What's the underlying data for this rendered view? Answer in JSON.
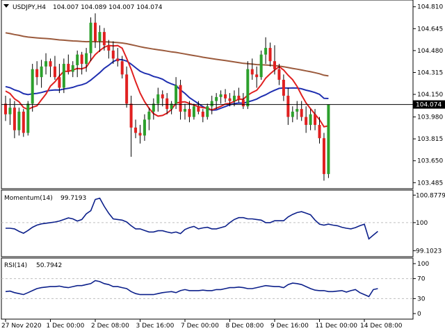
{
  "header": {
    "symbol": "USDJPY,H4",
    "ohlc": "104.007 104.089 104.007 104.074"
  },
  "colors": {
    "bull": "#2ca02c",
    "bear": "#e02020",
    "sma_fast": "#e02020",
    "sma_mid": "#1f2fb0",
    "sma_slow": "#9b5a3c",
    "indicator_line": "#0b1f8a",
    "grid": "#bfbfbf"
  },
  "chart_data": [
    {
      "type": "candlestick",
      "title": "USDJPY,H4",
      "ylim": [
        103.45,
        104.84
      ],
      "y_ticks": [
        "104.810",
        "104.645",
        "104.480",
        "104.315",
        "104.150",
        "103.980",
        "103.815",
        "103.650",
        "103.485"
      ],
      "current_price": "104.074",
      "x_labels": [
        "27 Nov 2020",
        "1 Dec 00:00",
        "2 Dec 08:00",
        "3 Dec 16:00",
        "7 Dec 00:00",
        "8 Dec 08:00",
        "9 Dec 16:00",
        "11 Dec 00:00",
        "14 Dec 08:00"
      ],
      "x_label_index": [
        0,
        10,
        20,
        30,
        40,
        50,
        60,
        70,
        80
      ],
      "candles": [
        [
          104.08,
          104.14,
          103.95,
          104.0
        ],
        [
          104.0,
          104.12,
          103.92,
          104.05
        ],
        [
          104.05,
          104.1,
          103.82,
          103.88
        ],
        [
          103.88,
          104.05,
          103.84,
          104.02
        ],
        [
          104.02,
          104.04,
          103.83,
          103.86
        ],
        [
          103.86,
          104.1,
          103.84,
          104.08
        ],
        [
          104.08,
          104.38,
          104.02,
          104.34
        ],
        [
          104.34,
          104.4,
          104.22,
          104.28
        ],
        [
          104.28,
          104.41,
          104.2,
          104.36
        ],
        [
          104.36,
          104.46,
          104.3,
          104.4
        ],
        [
          104.4,
          104.42,
          104.28,
          104.36
        ],
        [
          104.36,
          104.44,
          104.26,
          104.28
        ],
        [
          104.28,
          104.38,
          104.16,
          104.2
        ],
        [
          104.2,
          104.42,
          104.16,
          104.38
        ],
        [
          104.38,
          104.45,
          104.3,
          104.32
        ],
        [
          104.32,
          104.4,
          104.28,
          104.37
        ],
        [
          104.37,
          104.48,
          104.28,
          104.45
        ],
        [
          104.45,
          104.47,
          104.3,
          104.38
        ],
        [
          104.38,
          104.5,
          104.32,
          104.46
        ],
        [
          104.46,
          104.73,
          104.4,
          104.69
        ],
        [
          104.69,
          104.76,
          104.5,
          104.55
        ],
        [
          104.55,
          104.67,
          104.47,
          104.62
        ],
        [
          104.62,
          104.65,
          104.48,
          104.52
        ],
        [
          104.52,
          104.56,
          104.42,
          104.48
        ],
        [
          104.48,
          104.55,
          104.38,
          104.42
        ],
        [
          104.42,
          104.5,
          104.36,
          104.4
        ],
        [
          104.4,
          104.44,
          104.27,
          104.3
        ],
        [
          104.3,
          104.36,
          104.05,
          104.08
        ],
        [
          104.08,
          104.14,
          103.68,
          103.9
        ],
        [
          103.9,
          103.96,
          103.82,
          103.86
        ],
        [
          103.86,
          103.92,
          103.78,
          103.84
        ],
        [
          103.84,
          104.0,
          103.8,
          103.96
        ],
        [
          103.96,
          104.05,
          103.88,
          104.02
        ],
        [
          104.02,
          104.12,
          103.96,
          104.08
        ],
        [
          104.08,
          104.2,
          104.02,
          104.15
        ],
        [
          104.15,
          104.18,
          104.06,
          104.12
        ],
        [
          104.12,
          104.16,
          104.0,
          104.04
        ],
        [
          104.04,
          104.1,
          104.0,
          104.08
        ],
        [
          104.08,
          104.28,
          104.04,
          104.22
        ],
        [
          104.22,
          104.26,
          103.96,
          104.02
        ],
        [
          104.02,
          104.08,
          103.96,
          104.04
        ],
        [
          104.04,
          104.1,
          103.94,
          103.98
        ],
        [
          103.98,
          104.08,
          103.96,
          104.06
        ],
        [
          104.06,
          104.1,
          104.0,
          104.02
        ],
        [
          104.02,
          104.04,
          103.94,
          103.98
        ],
        [
          103.98,
          104.08,
          103.96,
          104.06
        ],
        [
          104.06,
          104.14,
          104.0,
          104.1
        ],
        [
          104.1,
          104.16,
          104.04,
          104.13
        ],
        [
          104.13,
          104.18,
          104.08,
          104.15
        ],
        [
          104.15,
          104.19,
          104.09,
          104.12
        ],
        [
          104.12,
          104.16,
          104.06,
          104.1
        ],
        [
          104.1,
          104.18,
          104.06,
          104.14
        ],
        [
          104.14,
          104.2,
          104.09,
          104.11
        ],
        [
          104.11,
          104.16,
          104.04,
          104.06
        ],
        [
          104.06,
          104.4,
          104.04,
          104.34
        ],
        [
          104.34,
          104.42,
          104.26,
          104.3
        ],
        [
          104.3,
          104.36,
          104.2,
          104.28
        ],
        [
          104.28,
          104.48,
          104.26,
          104.45
        ],
        [
          104.45,
          104.58,
          104.38,
          104.5
        ],
        [
          104.5,
          104.54,
          104.36,
          104.4
        ],
        [
          104.4,
          104.52,
          104.3,
          104.34
        ],
        [
          104.34,
          104.38,
          104.22,
          104.26
        ],
        [
          104.26,
          104.3,
          104.1,
          104.14
        ],
        [
          104.14,
          104.2,
          103.92,
          103.98
        ],
        [
          103.98,
          104.06,
          103.94,
          104.02
        ],
        [
          104.02,
          104.1,
          103.96,
          104.04
        ],
        [
          104.04,
          104.1,
          103.95,
          103.98
        ],
        [
          103.98,
          104.06,
          103.86,
          103.92
        ],
        [
          103.92,
          104.04,
          103.88,
          104.0
        ],
        [
          104.0,
          104.04,
          103.88,
          103.92
        ],
        [
          103.92,
          103.98,
          103.78,
          103.82
        ],
        [
          103.82,
          103.86,
          103.5,
          103.55
        ],
        [
          103.55,
          104.06,
          103.52,
          104.074
        ]
      ]
    },
    {
      "type": "line",
      "title": "Momentum(14) 99.7193",
      "name_label": "Momentum(14)",
      "value_label": "99.7193",
      "y_ticks": [
        "100.8779",
        "100",
        "99.1023"
      ],
      "ylim": [
        99.0,
        100.95
      ],
      "values": [
        99.82,
        99.82,
        99.8,
        99.72,
        99.66,
        99.75,
        99.85,
        99.92,
        99.96,
        99.98,
        100.0,
        100.02,
        100.05,
        100.1,
        100.15,
        100.12,
        100.05,
        100.1,
        100.28,
        100.38,
        100.74,
        100.78,
        100.52,
        100.3,
        100.12,
        100.1,
        100.08,
        100.02,
        99.9,
        99.8,
        99.8,
        99.75,
        99.7,
        99.7,
        99.74,
        99.74,
        99.7,
        99.67,
        99.7,
        99.65,
        99.78,
        99.84,
        99.88,
        99.8,
        99.83,
        99.85,
        99.8,
        99.8,
        99.84,
        99.88,
        100.0,
        100.1,
        100.16,
        100.16,
        100.12,
        100.12,
        100.1,
        100.08,
        100.0,
        100.0,
        100.06,
        100.06,
        100.06,
        100.18,
        100.26,
        100.32,
        100.35,
        100.3,
        100.25,
        100.08,
        99.95,
        99.92,
        99.95,
        99.92,
        99.9,
        99.85,
        99.82,
        99.8,
        99.84,
        99.9,
        99.95,
        99.48,
        99.6,
        99.72
      ],
      "reference_level": 100
    },
    {
      "type": "line",
      "title": "RSI(14) 50.7942",
      "name_label": "RSI(14)",
      "value_label": "50.7942",
      "y_ticks": [
        "100",
        "70",
        "30",
        "0"
      ],
      "ylim": [
        0,
        100
      ],
      "levels": [
        70,
        30
      ],
      "values": [
        44,
        45,
        42,
        40,
        38,
        42,
        46,
        50,
        52,
        53,
        54,
        54,
        55,
        53,
        52,
        54,
        56,
        56,
        58,
        60,
        66,
        64,
        60,
        58,
        54,
        54,
        52,
        50,
        44,
        40,
        38,
        38,
        38,
        38,
        40,
        42,
        43,
        44,
        42,
        46,
        48,
        46,
        46,
        46,
        47,
        46,
        46,
        48,
        48,
        50,
        52,
        52,
        53,
        52,
        50,
        50,
        52,
        54,
        56,
        55,
        54,
        54,
        52,
        58,
        61,
        60,
        58,
        54,
        50,
        47,
        46,
        46,
        44,
        44,
        45,
        46,
        43,
        46,
        48,
        42,
        38,
        34,
        48,
        50
      ]
    }
  ]
}
